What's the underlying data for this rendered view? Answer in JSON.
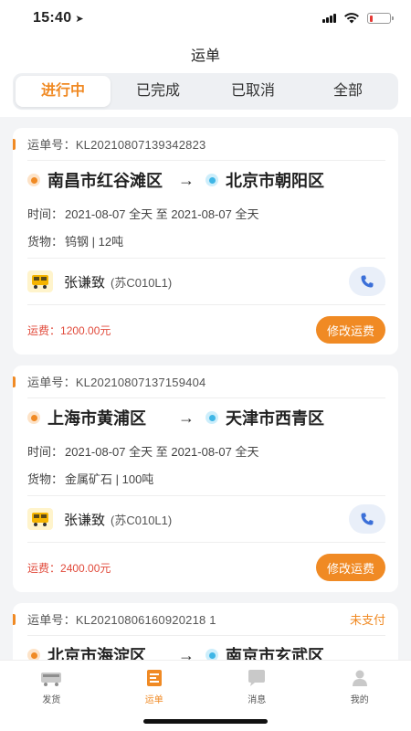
{
  "status": {
    "time": "15:40"
  },
  "nav": {
    "title": "运单"
  },
  "tabs": [
    {
      "label": "进行中",
      "active": true
    },
    {
      "label": "已完成",
      "active": false
    },
    {
      "label": "已取消",
      "active": false
    },
    {
      "label": "全部",
      "active": false
    }
  ],
  "labels": {
    "order_no": "运单号：",
    "time": "时间：",
    "goods": "货物：",
    "fee": "运费：",
    "edit_fee": "修改运费"
  },
  "orders": [
    {
      "no": "KL20210807139342823",
      "status": "",
      "from": "南昌市红谷滩区",
      "to": "北京市朝阳区",
      "time": "2021-08-07 全天 至 2021-08-07 全天",
      "goods": "钨钢 | 12吨",
      "driver": "张谦致",
      "plate": "(苏C010L1)",
      "fee": "1200.00元"
    },
    {
      "no": "KL20210807137159404",
      "status": "",
      "from": "上海市黄浦区",
      "to": "天津市西青区",
      "time": "2021-08-07 全天 至 2021-08-07 全天",
      "goods": "金属矿石 | 100吨",
      "driver": "张谦致",
      "plate": "(苏C010L1)",
      "fee": "2400.00元"
    },
    {
      "no": "KL20210806160920218 1",
      "status": "未支付",
      "from": "北京市海淀区",
      "to": "南京市玄武区"
    }
  ],
  "tabbar": [
    {
      "label": "发货",
      "icon": "truck-icon",
      "active": false
    },
    {
      "label": "运单",
      "icon": "waybill-icon",
      "active": true
    },
    {
      "label": "消息",
      "icon": "message-icon",
      "active": false
    },
    {
      "label": "我的",
      "icon": "profile-icon",
      "active": false
    }
  ],
  "colors": {
    "accent": "#f08a24",
    "fee": "#e14a3b",
    "from_dot": "#f08a24",
    "to_dot": "#3fb6e6"
  }
}
